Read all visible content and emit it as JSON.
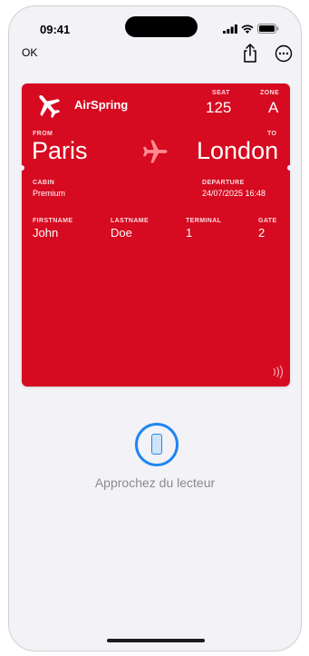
{
  "status_bar": {
    "time": "09:41"
  },
  "nav": {
    "ok_label": "OK",
    "share_icon": "share-icon",
    "more_icon": "ellipsis-circle-icon"
  },
  "pass": {
    "background_color": "#d60a20",
    "brand": "AirSpring",
    "seat": {
      "label": "SEAT",
      "value": "125"
    },
    "zone": {
      "label": "ZONE",
      "value": "A"
    },
    "from": {
      "label": "FROM",
      "value": "Paris"
    },
    "to": {
      "label": "TO",
      "value": "London"
    },
    "cabin": {
      "label": "CABIN",
      "value": "Premium"
    },
    "departure": {
      "label": "DEPARTURE",
      "value": "24/07/2025 16:48"
    },
    "firstname": {
      "label": "FIRSTNAME",
      "value": "John"
    },
    "lastname": {
      "label": "LASTNAME",
      "value": "Doe"
    },
    "terminal": {
      "label": "TERMINAL",
      "value": "1"
    },
    "gate": {
      "label": "GATE",
      "value": "2"
    }
  },
  "reader": {
    "message": "Approchez du lecteur",
    "accent_color": "#1f86f0"
  }
}
